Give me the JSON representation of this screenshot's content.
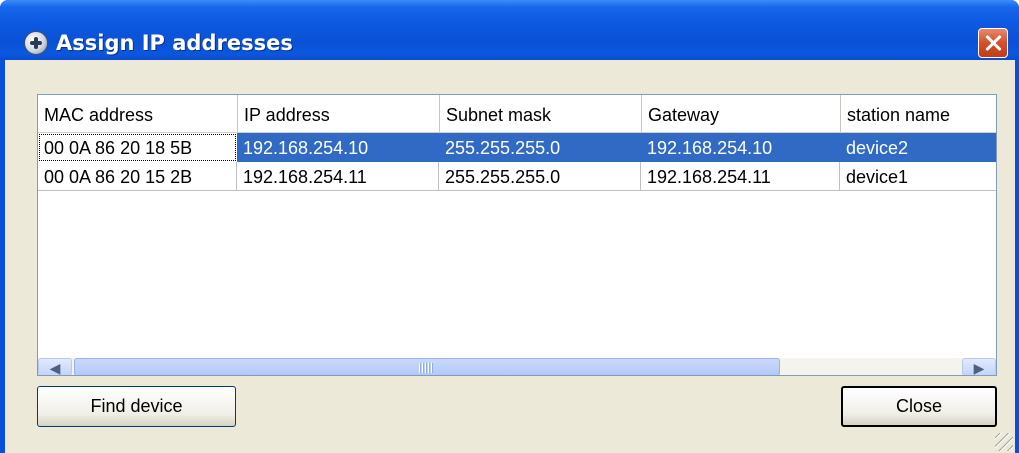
{
  "window": {
    "title": "Assign IP addresses"
  },
  "table": {
    "columns": [
      "MAC address",
      "IP address",
      "Subnet mask",
      "Gateway",
      "station name"
    ],
    "rows": [
      {
        "mac": "00 0A 86 20 18 5B",
        "ip": "192.168.254.10",
        "subnet": "255.255.255.0",
        "gateway": "192.168.254.10",
        "station": "device2",
        "selected": true
      },
      {
        "mac": "00 0A 86 20 15 2B",
        "ip": "192.168.254.11",
        "subnet": "255.255.255.0",
        "gateway": "192.168.254.11",
        "station": "device1",
        "selected": false
      }
    ]
  },
  "buttons": {
    "find": "Find device",
    "close": "Close"
  },
  "icons": {
    "app": "network-globe-icon",
    "close": "close-icon",
    "scroll_left": "arrow-left-icon",
    "scroll_right": "arrow-right-icon"
  },
  "colors": {
    "title_bar": "#0a52d6",
    "selection": "#316ac5",
    "dialog_bg": "#ece9d8"
  }
}
